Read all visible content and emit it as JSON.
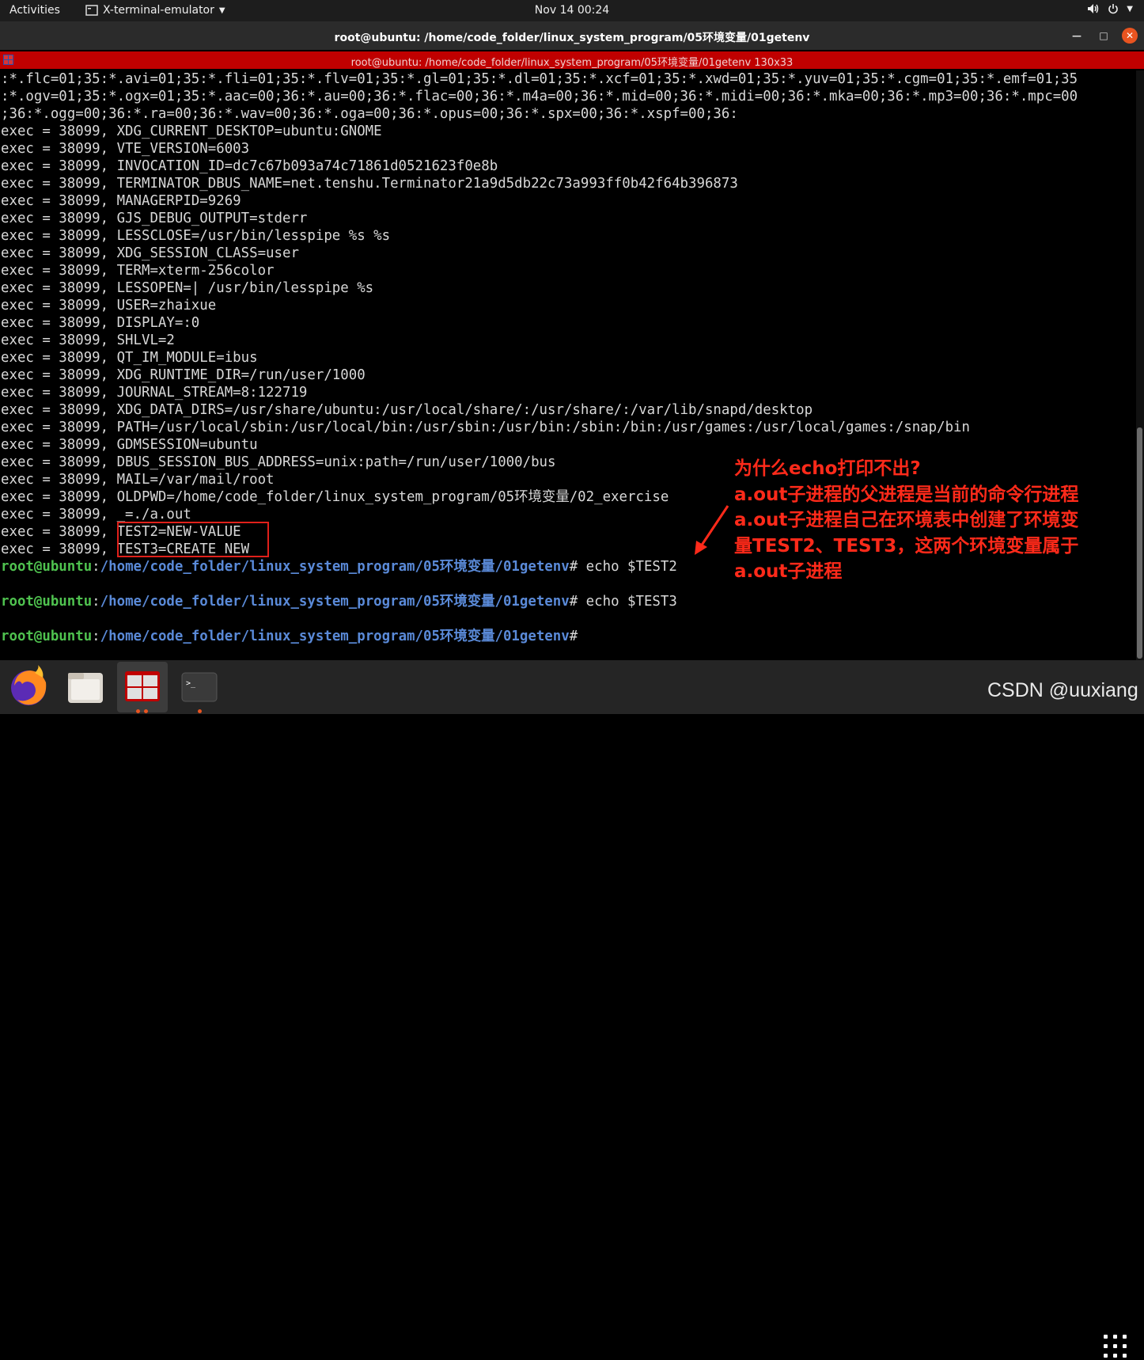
{
  "topbar": {
    "activities": "Activities",
    "app_name": "X-terminal-emulator",
    "clock": "Nov 14  00:24"
  },
  "window": {
    "title": "root@ubuntu: /home/code_folder/linux_system_program/05环境变量/01getenv"
  },
  "terminal_bar": {
    "title": "root@ubuntu: /home/code_folder/linux_system_program/05环境变量/01getenv 130x33"
  },
  "terminal": {
    "output_lines": [
      ":*.flc=01;35:*.avi=01;35:*.fli=01;35:*.flv=01;35:*.gl=01;35:*.dl=01;35:*.xcf=01;35:*.xwd=01;35:*.yuv=01;35:*.cgm=01;35:*.emf=01;35",
      ":*.ogv=01;35:*.ogx=01;35:*.aac=00;36:*.au=00;36:*.flac=00;36:*.m4a=00;36:*.mid=00;36:*.midi=00;36:*.mka=00;36:*.mp3=00;36:*.mpc=00",
      ";36:*.ogg=00;36:*.ra=00;36:*.wav=00;36:*.oga=00;36:*.opus=00;36:*.spx=00;36:*.xspf=00;36:",
      "exec = 38099, XDG_CURRENT_DESKTOP=ubuntu:GNOME",
      "exec = 38099, VTE_VERSION=6003",
      "exec = 38099, INVOCATION_ID=dc7c67b093a74c71861d0521623f0e8b",
      "exec = 38099, TERMINATOR_DBUS_NAME=net.tenshu.Terminator21a9d5db22c73a993ff0b42f64b396873",
      "exec = 38099, MANAGERPID=9269",
      "exec = 38099, GJS_DEBUG_OUTPUT=stderr",
      "exec = 38099, LESSCLOSE=/usr/bin/lesspipe %s %s",
      "exec = 38099, XDG_SESSION_CLASS=user",
      "exec = 38099, TERM=xterm-256color",
      "exec = 38099, LESSOPEN=| /usr/bin/lesspipe %s",
      "exec = 38099, USER=zhaixue",
      "exec = 38099, DISPLAY=:0",
      "exec = 38099, SHLVL=2",
      "exec = 38099, QT_IM_MODULE=ibus",
      "exec = 38099, XDG_RUNTIME_DIR=/run/user/1000",
      "exec = 38099, JOURNAL_STREAM=8:122719",
      "exec = 38099, XDG_DATA_DIRS=/usr/share/ubuntu:/usr/local/share/:/usr/share/:/var/lib/snapd/desktop",
      "exec = 38099, PATH=/usr/local/sbin:/usr/local/bin:/usr/sbin:/usr/bin:/sbin:/bin:/usr/games:/usr/local/games:/snap/bin",
      "exec = 38099, GDMSESSION=ubuntu",
      "exec = 38099, DBUS_SESSION_BUS_ADDRESS=unix:path=/run/user/1000/bus",
      "exec = 38099, MAIL=/var/mail/root",
      "exec = 38099, OLDPWD=/home/code_folder/linux_system_program/05环境变量/02_exercise",
      "exec = 38099, _=./a.out",
      "exec = 38099, TEST2=NEW-VALUE",
      "exec = 38099, TEST3=CREATE NEW"
    ],
    "prompts": [
      {
        "user": "root@ubuntu",
        "sep": ":",
        "path": "/home/code_folder/linux_system_program/05环境变量/01getenv",
        "suffix": "# echo $TEST2"
      },
      {
        "user": "root@ubuntu",
        "sep": ":",
        "path": "/home/code_folder/linux_system_program/05环境变量/01getenv",
        "suffix": "# echo $TEST3"
      },
      {
        "user": "root@ubuntu",
        "sep": ":",
        "path": "/home/code_folder/linux_system_program/05环境变量/01getenv",
        "suffix": "#"
      }
    ]
  },
  "annotation": {
    "lines": [
      "为什么echo打印不出?",
      "a.out子进程的父进程是当前的命令行进程",
      "a.out子进程自己在环境表中创建了环境变",
      "量TEST2、TEST3，这两个环境变量属于",
      "a.out子进程"
    ]
  },
  "dock": {
    "apps": [
      "firefox-icon",
      "files-icon",
      "terminator-icon",
      "terminal-icon"
    ]
  },
  "watermark": "CSDN @uuxiang",
  "colors": {
    "terminal_bar": "#c00000",
    "prompt_user": "#4fc24f",
    "prompt_path": "#5a8ad8",
    "annotation": "#ff2a1a",
    "ubuntu_orange": "#e95420"
  }
}
